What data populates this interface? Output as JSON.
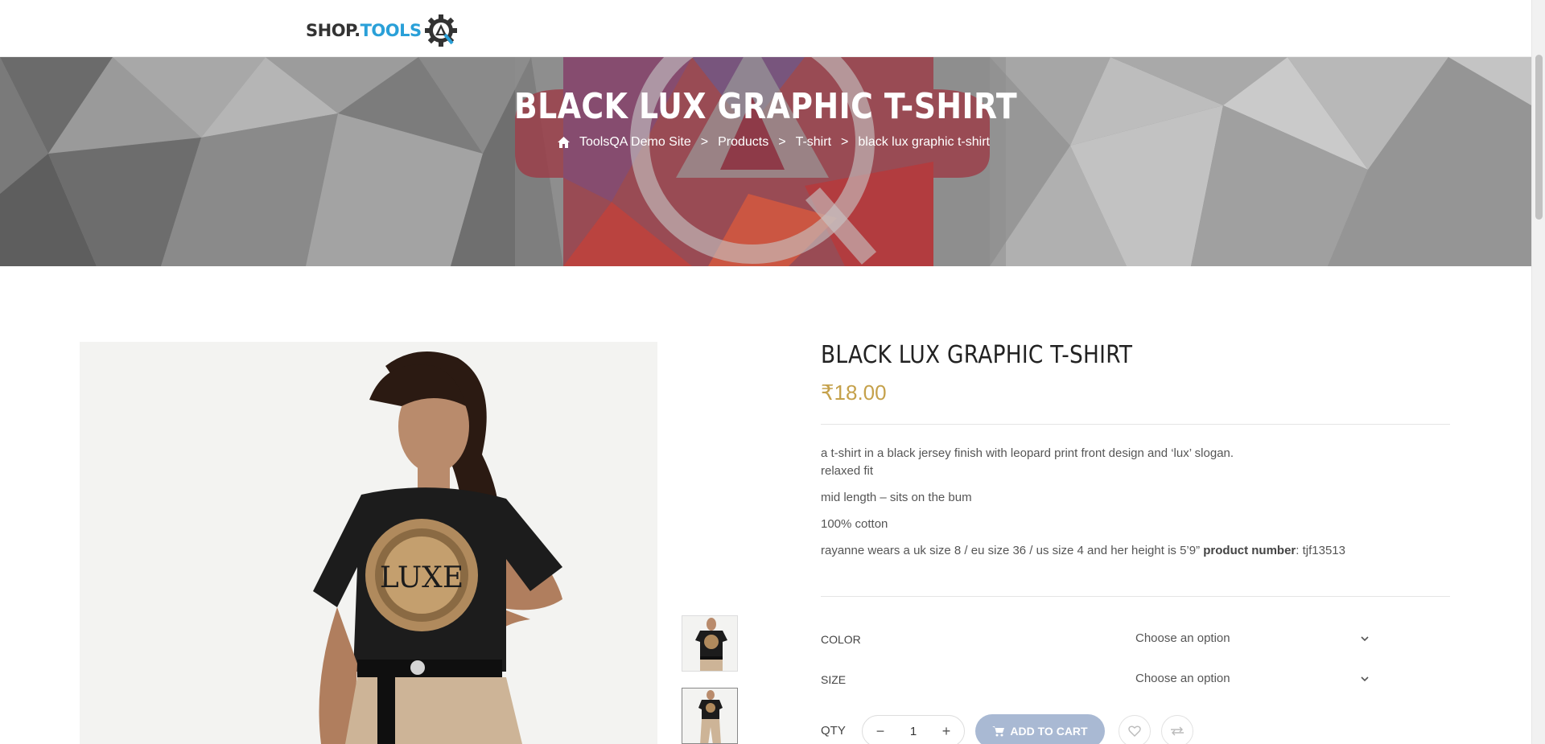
{
  "header": {
    "logo_text_main": "SHOP.",
    "logo_text_accent": "TOOLS"
  },
  "hero": {
    "title": "BLACK LUX GRAPHIC T-SHIRT",
    "breadcrumb": [
      "ToolsQA Demo Site",
      "Products",
      "T-shirt",
      "black lux graphic t-shirt"
    ],
    "separator": ">"
  },
  "product": {
    "title": "BLACK LUX GRAPHIC T-SHIRT",
    "price": "₹18.00",
    "description": {
      "line1": "a t-shirt in a black jersey finish with leopard print front design and ‘lux’ slogan.",
      "line2": "relaxed fit",
      "line3": "mid length – sits on the bum",
      "line4": "100% cotton",
      "line5_prefix": "rayanne wears a uk size 8 / eu size 36 / us size 4 and her height is 5’9” ",
      "line5_bold": "product number",
      "line5_suffix": ": tjf13513"
    },
    "variations": [
      {
        "label": "COLOR",
        "value": "Choose an option"
      },
      {
        "label": "SIZE",
        "value": "Choose an option"
      }
    ],
    "qty_label": "QTY",
    "qty_value": "1",
    "qty_minus": "−",
    "qty_plus": "+",
    "add_to_cart_label": "ADD TO CART"
  },
  "colors": {
    "price": "#c5a14b",
    "add_to_cart_bg": "#a9b9d3",
    "logo_accent": "#2aa0d8"
  },
  "icons": [
    "gear-logo-icon",
    "home-icon",
    "chevron-down-icon",
    "cart-icon",
    "heart-icon",
    "compare-icon"
  ]
}
